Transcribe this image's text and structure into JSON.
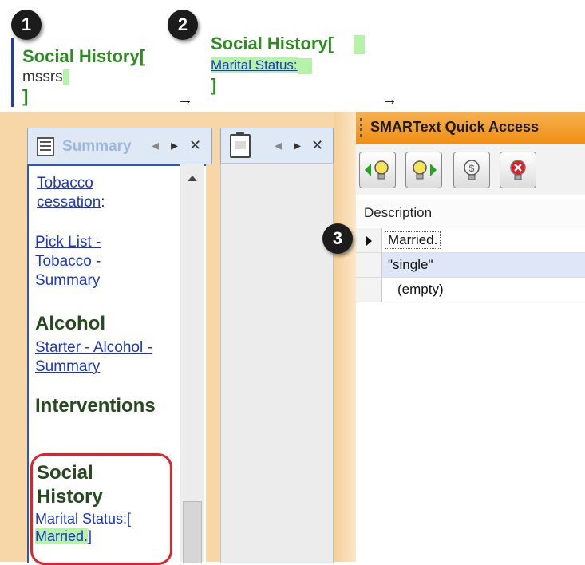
{
  "steps": {
    "one": "1",
    "two": "2",
    "three": "3"
  },
  "step1": {
    "title": "Social History[",
    "typed_text": "mssrs",
    "close_bracket": "]"
  },
  "step2": {
    "title": "Social History[",
    "field_label": "Marital Status:",
    "close_bracket": "]"
  },
  "arrows": {
    "a": "→",
    "b": "→"
  },
  "summary_panel": {
    "tab_title": "Summary",
    "tab_controls": {
      "left": "◂",
      "right": "▸",
      "close": "✕"
    },
    "items": {
      "tobacco_link_line1": "Tobacco",
      "tobacco_link_line2": "cessation",
      "colon": ":",
      "picklist_line1": "Pick List -",
      "picklist_line2": "Tobacco -",
      "picklist_line3": "Summary",
      "alcohol_heading": "Alcohol",
      "alcohol_link_line1": "Starter - Alcohol -",
      "alcohol_link_line2": "Summary",
      "interventions_heading": "Interventions",
      "social_heading_line1": "Social",
      "social_heading_line2": "History",
      "marital_line": "Marital Status:[",
      "married_value": "Married.",
      "married_close": "]"
    }
  },
  "middle_panel": {
    "tab_controls": {
      "left": "◂",
      "right": "▸",
      "close": "✕"
    }
  },
  "smartext_panel": {
    "title": "SMARText Quick Access",
    "column_header": "Description",
    "rows": [
      {
        "text": "Married.",
        "selected": false,
        "current": true
      },
      {
        "text": "\"single\"",
        "selected": true,
        "current": false
      },
      {
        "text": "(empty)",
        "selected": false,
        "current": false
      }
    ]
  },
  "colors": {
    "accent_green": "#2e8b22",
    "link_blue": "#1a36c8",
    "highlight": "#b6f3a8",
    "frame_orange": "#f7d6a8",
    "red_callout": "#e0222a"
  }
}
